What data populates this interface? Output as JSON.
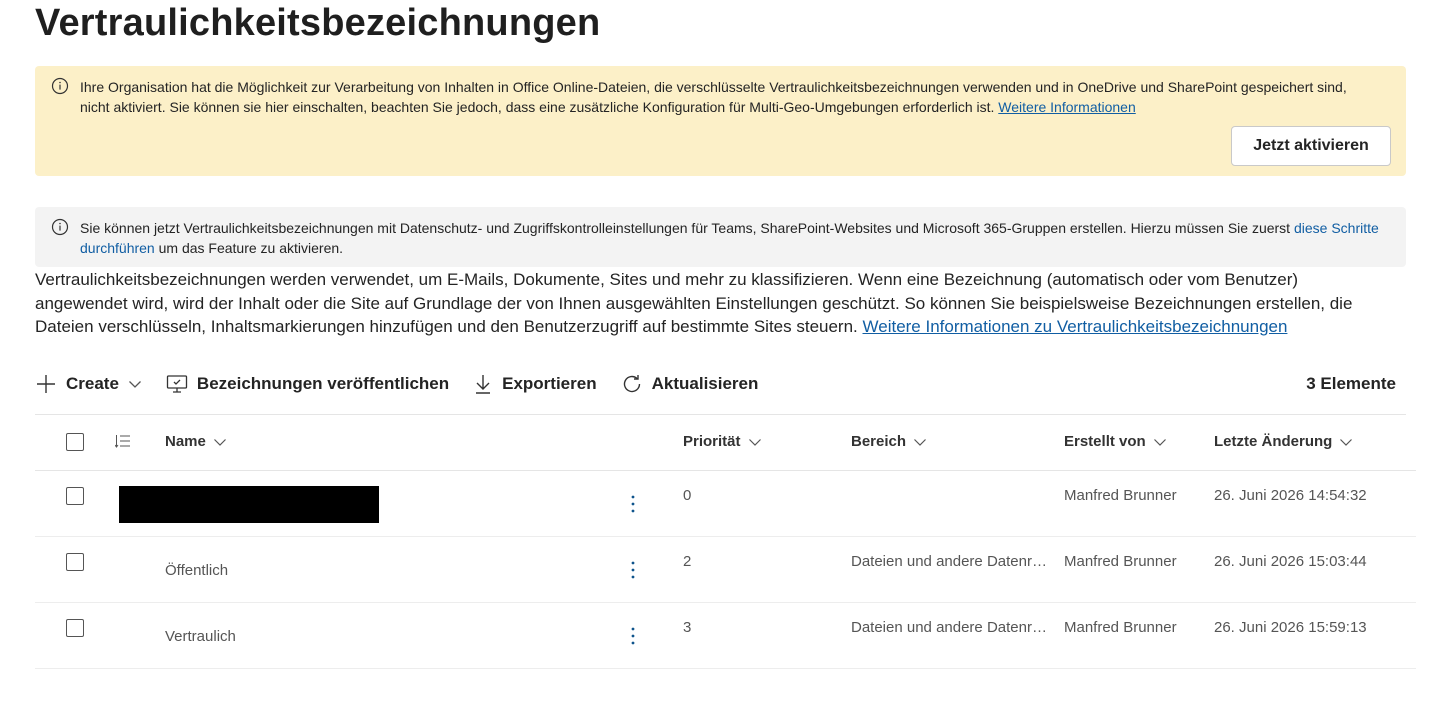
{
  "page": {
    "title": "Vertraulichkeitsbezeichnungen"
  },
  "banner_warning": {
    "icon": "info-icon",
    "text": "Ihre Organisation hat die Möglichkeit zur Verarbeitung von Inhalten in Office Online-Dateien, die verschlüsselte Vertraulichkeitsbezeichnungen verwenden und in OneDrive und SharePoint gespeichert sind, nicht aktiviert. Sie können sie hier einschalten, beachten Sie jedoch, dass eine zusätzliche Konfiguration für Multi-Geo-Umgebungen erforderlich ist. ",
    "link": "Weitere Informationen",
    "button": "Jetzt aktivieren"
  },
  "banner_info": {
    "icon": "info-icon",
    "text": "Sie können jetzt Vertraulichkeitsbezeichnungen mit Datenschutz- und Zugriffskontrolleinstellungen für Teams, SharePoint-Websites und Microsoft 365-Gruppen erstellen. Hierzu müssen Sie zuerst ",
    "link": "diese Schritte durchführen",
    "text_after": " um das Feature zu aktivieren."
  },
  "description": {
    "text": "Vertraulichkeitsbezeichnungen werden verwendet, um E-Mails, Dokumente, Sites und mehr zu klassifizieren. Wenn eine Bezeichnung (automatisch oder vom Benutzer) angewendet wird, wird der Inhalt oder die Site auf Grundlage der von Ihnen ausgewählten Einstellungen geschützt. So können Sie beispielsweise Bezeichnungen erstellen, die Dateien verschlüsseln, Inhaltsmarkierungen hinzufügen und den Benutzerzugriff auf bestimmte Sites steuern. ",
    "link": "Weitere Informationen zu Vertraulichkeitsbezeichnungen"
  },
  "toolbar": {
    "create": "Create",
    "publish": "Bezeichnungen veröffentlichen",
    "export": "Exportieren",
    "refresh": "Aktualisieren",
    "count": "3 Elemente"
  },
  "table": {
    "headers": {
      "name": "Name",
      "priority": "Priorität",
      "scope": "Bereich",
      "created_by": "Erstellt von",
      "modified": "Letzte Änderung"
    },
    "rows": [
      {
        "name": "",
        "redacted": true,
        "priority": "0",
        "scope": "",
        "created_by": "Manfred Brunner",
        "modified": "26. Juni 2026 14:54:32"
      },
      {
        "name": "Öffentlich",
        "priority": "2",
        "scope": "Dateien und andere Datenressourcen",
        "created_by": "Manfred Brunner",
        "modified": "26. Juni 2026 15:03:44"
      },
      {
        "name": "Vertraulich",
        "priority": "3",
        "scope": "Dateien und andere Datenressourcen",
        "created_by": "Manfred Brunner",
        "modified": "26. Juni 2026 15:59:13"
      }
    ]
  }
}
